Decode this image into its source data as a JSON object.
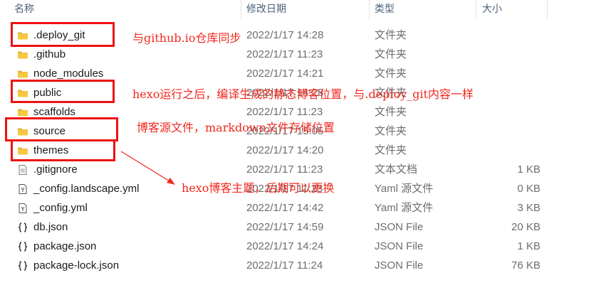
{
  "columns": {
    "name": "名称",
    "date": "修改日期",
    "type": "类型",
    "size": "大小"
  },
  "files": [
    {
      "name": ".deploy_git",
      "date": "2022/1/17 14:28",
      "type": "文件夹",
      "size": "",
      "icon": "folder-icon"
    },
    {
      "name": ".github",
      "date": "2022/1/17 11:23",
      "type": "文件夹",
      "size": "",
      "icon": "folder-icon"
    },
    {
      "name": "node_modules",
      "date": "2022/1/17 14:21",
      "type": "文件夹",
      "size": "",
      "icon": "folder-icon"
    },
    {
      "name": "public",
      "date": "2022/1/17 14:28",
      "type": "文件夹",
      "size": "",
      "icon": "folder-icon"
    },
    {
      "name": "scaffolds",
      "date": "2022/1/17 11:23",
      "type": "文件夹",
      "size": "",
      "icon": "folder-icon"
    },
    {
      "name": "source",
      "date": "2022/1/17 15:05",
      "type": "文件夹",
      "size": "",
      "icon": "folder-icon"
    },
    {
      "name": "themes",
      "date": "2022/1/17 14:20",
      "type": "文件夹",
      "size": "",
      "icon": "folder-icon"
    },
    {
      "name": ".gitignore",
      "date": "2022/1/17 11:23",
      "type": "文本文档",
      "size": "1 KB",
      "icon": "text-file-icon"
    },
    {
      "name": "_config.landscape.yml",
      "date": "2022/1/17 11:23",
      "type": "Yaml 源文件",
      "size": "0 KB",
      "icon": "yaml-file-icon"
    },
    {
      "name": "_config.yml",
      "date": "2022/1/17 14:42",
      "type": "Yaml 源文件",
      "size": "3 KB",
      "icon": "yaml-file-icon"
    },
    {
      "name": "db.json",
      "date": "2022/1/17 14:59",
      "type": "JSON File",
      "size": "20 KB",
      "icon": "json-file-icon"
    },
    {
      "name": "package.json",
      "date": "2022/1/17 14:24",
      "type": "JSON File",
      "size": "1 KB",
      "icon": "json-file-icon"
    },
    {
      "name": "package-lock.json",
      "date": "2022/1/17 11:24",
      "type": "JSON File",
      "size": "76 KB",
      "icon": "json-file-icon"
    }
  ],
  "annotations": {
    "deploy_git_note": "与github.io仓库同步",
    "public_note": "hexo运行之后，编译生成的静态博客位置，与.deploy_git内容一样",
    "source_note": "博客源文件，markdown文件存储位置",
    "themes_note": "hexo博客主题，后期可以更换"
  },
  "colors": {
    "annotation": "#f0281e",
    "folder": "#f5c842",
    "header_text": "#4c607a"
  }
}
